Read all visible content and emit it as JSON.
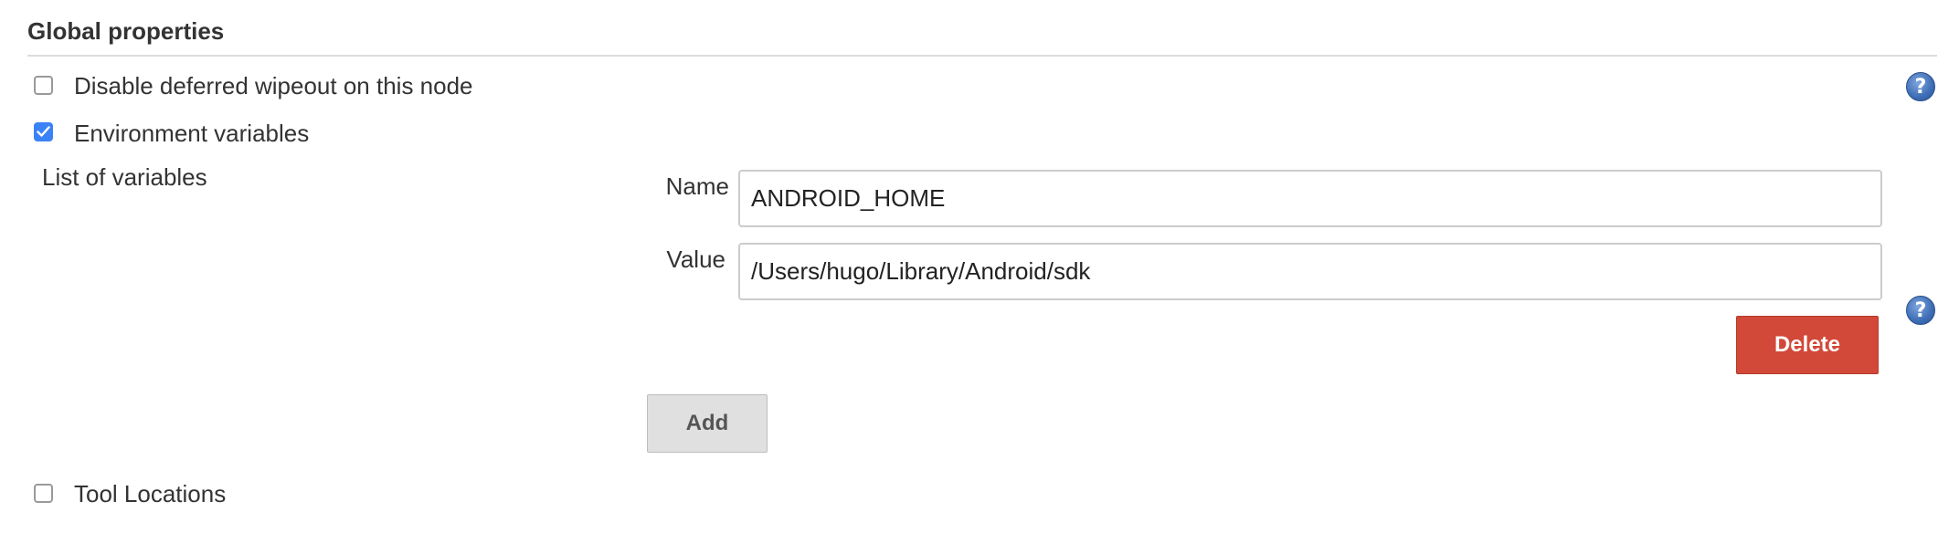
{
  "section": {
    "title": "Global properties"
  },
  "options": {
    "disable_wipeout": {
      "label": "Disable deferred wipeout on this node",
      "checked": false
    },
    "env_vars": {
      "label": "Environment variables",
      "checked": true
    },
    "tool_locations": {
      "label": "Tool Locations",
      "checked": false
    }
  },
  "env_list": {
    "label": "List of variables",
    "name_label": "Name",
    "name_value": "ANDROID_HOME",
    "value_label": "Value",
    "value_value": "/Users/hugo/Library/Android/sdk",
    "delete_label": "Delete",
    "add_label": "Add"
  },
  "help": {
    "glyph": "?"
  },
  "colors": {
    "checkbox_checked": "#3b82f6",
    "delete_button": "#d24939",
    "add_button": "#e0e0e0",
    "help_icon": "#3d6db5"
  }
}
